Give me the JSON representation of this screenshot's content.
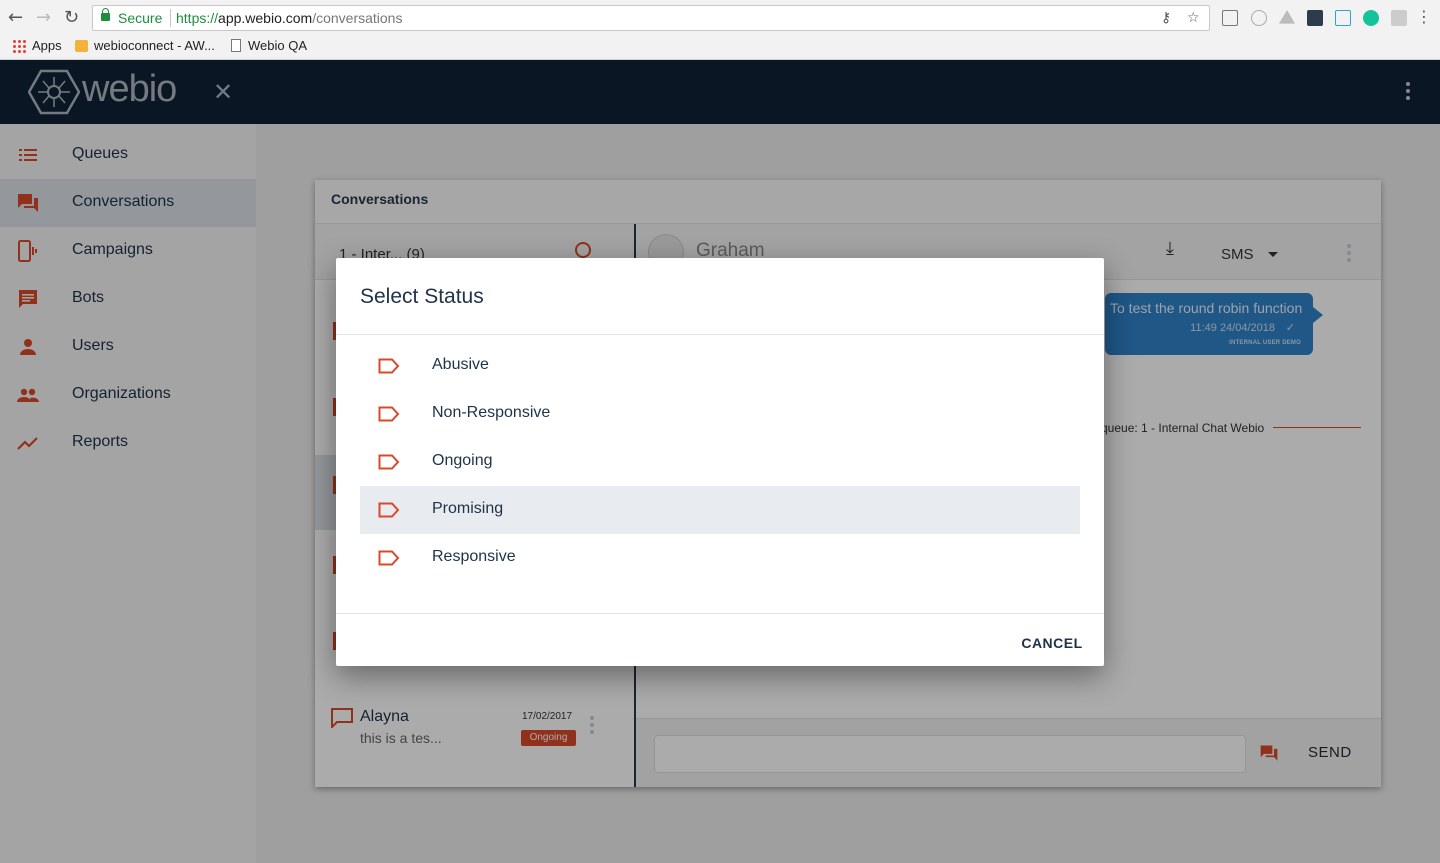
{
  "browser": {
    "secure_label": "Secure",
    "url_scheme": "https://",
    "url_host": "app.webio.com",
    "url_path": "/conversations",
    "bookmarks": [
      "Apps",
      "webioconnect - AW...",
      "Webio QA"
    ]
  },
  "app": {
    "logo_text": "webio",
    "close_icon": "close-icon",
    "menu_icon": "more-vert-icon"
  },
  "sidebar": {
    "items": [
      {
        "label": "Queues",
        "icon": "list-icon"
      },
      {
        "label": "Conversations",
        "icon": "forum-icon"
      },
      {
        "label": "Campaigns",
        "icon": "phone-vibrate-icon"
      },
      {
        "label": "Bots",
        "icon": "chat-icon"
      },
      {
        "label": "Users",
        "icon": "person-icon"
      },
      {
        "label": "Organizations",
        "icon": "people-icon"
      },
      {
        "label": "Reports",
        "icon": "trending-up-icon"
      }
    ],
    "active_index": 1
  },
  "conversations": {
    "title": "Conversations",
    "queue_select": "1 - Inter... (9)",
    "contact_name": "Graham",
    "channel": "SMS",
    "message_text": "To test the round robin function",
    "message_time": "11:49 24/04/2018",
    "message_user": "INTERNAL USER DEMO",
    "queue_note": "queue: 1 - Internal Chat Webio",
    "send_label": "SEND",
    "list_item": {
      "name": "Alayna",
      "preview": "this is a tes...",
      "date": "17/02/2017",
      "status": "Ongoing"
    }
  },
  "dialog": {
    "title": "Select Status",
    "options": [
      "Abusive",
      "Non-Responsive",
      "Ongoing",
      "Promising",
      "Responsive"
    ],
    "highlighted_index": 3,
    "cancel_label": "CANCEL"
  },
  "colors": {
    "header": "#0f2236",
    "accent": "#d94a2b",
    "text": "#1f3248",
    "bubble": "#2f82c9"
  }
}
